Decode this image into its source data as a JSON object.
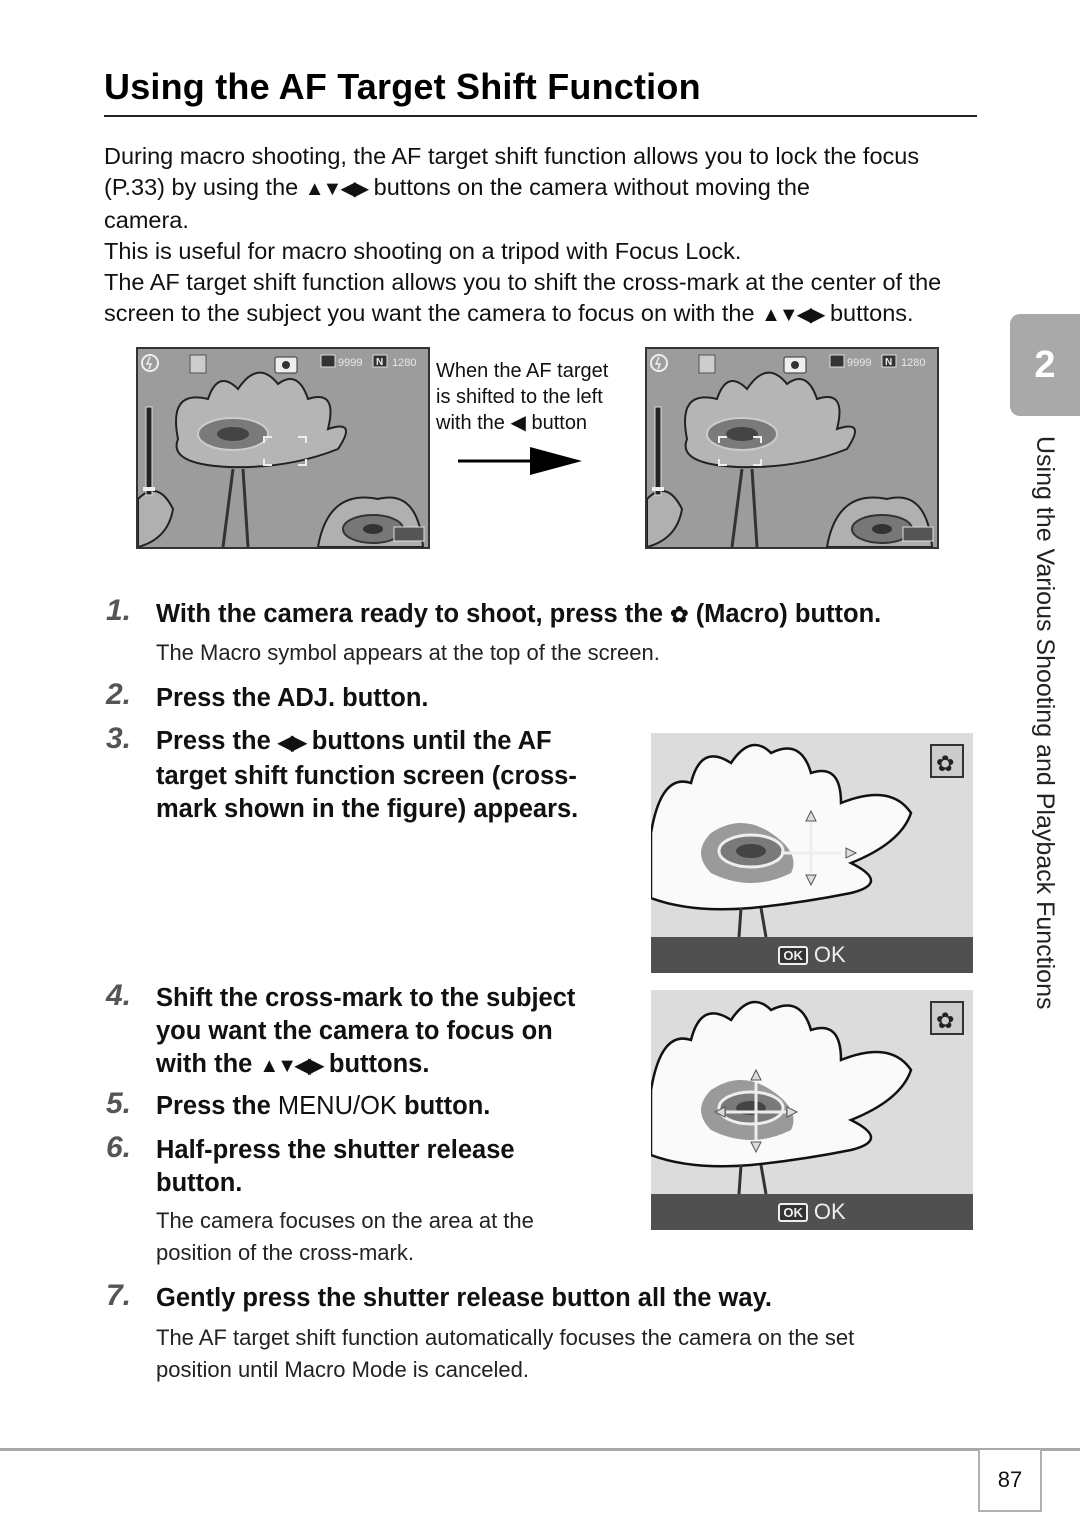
{
  "title": "Using the AF Target Shift Function",
  "intro": {
    "line1": "During macro shooting, the AF target shift function allows you to lock the focus",
    "line2a": "(P.33) by using the",
    "arrows": "▲▼◀▶",
    "line2b": "buttons on the camera without moving the",
    "line3": "camera.",
    "line4": "This is useful for macro shooting on a tripod with Focus Lock.",
    "line5": "The AF target shift function allows you to shift the cross-mark at the center of the",
    "line6a": "screen to the subject you want the camera to focus on with the",
    "line6b": "buttons."
  },
  "figure": {
    "caption_line1": "When the AF target",
    "caption_line2": "is shifted to the left",
    "caption_line3a": "with the",
    "caption_left_arrow": "◀",
    "caption_line3b": "button",
    "screen_status": {
      "shots_remaining": "9999",
      "quality": "N",
      "size": "1280"
    }
  },
  "steps": [
    {
      "num": "1.",
      "title_a": "With the camera ready to shoot, press the",
      "icon": "macro",
      "title_b": "(Macro) button.",
      "desc": "The Macro symbol appears at the top of the screen."
    },
    {
      "num": "2.",
      "title": "Press the ADJ. button."
    },
    {
      "num": "3.",
      "title_a": "Press the",
      "arrows": "◀▶",
      "title_b": "buttons until the AF",
      "title_line2": "target shift function screen (cross-",
      "title_line3": "mark shown in the figure) appears."
    },
    {
      "num": "4.",
      "title_line1": "Shift the cross-mark to the subject",
      "title_line2": "you want the camera to focus on",
      "title_a": "with the",
      "arrows": "▲▼◀▶",
      "title_b": "buttons."
    },
    {
      "num": "5.",
      "title_a": "Press the",
      "menu_ok": "MENU/OK",
      "title_b": "button."
    },
    {
      "num": "6.",
      "title_line1": "Half-press the shutter release",
      "title_line2": "button.",
      "desc_line1": "The camera focuses on the area at the",
      "desc_line2": "position of the cross-mark."
    },
    {
      "num": "7.",
      "title": "Gently press the shutter release button all the way.",
      "desc_line1": "The AF target shift function automatically focuses the camera on the set",
      "desc_line2": "position until Macro Mode is canceled."
    }
  ],
  "lcd": {
    "ok_icon": "OK",
    "ok_label": "OK"
  },
  "side": {
    "chapter_number": "2",
    "chapter_label": "Using the Various Shooting and Playback Functions"
  },
  "footer": {
    "page_number": "87"
  }
}
